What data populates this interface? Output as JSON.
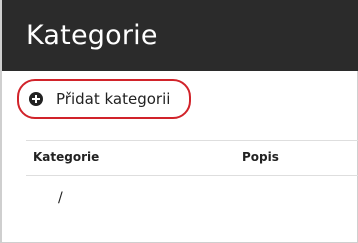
{
  "header": {
    "title": "Kategorie"
  },
  "toolbar": {
    "add_label": "Přidat kategorii",
    "add_icon": "plus-circle-icon",
    "highlight_color": "#d1232a"
  },
  "table": {
    "columns": [
      "Kategorie",
      "Popis"
    ],
    "rows": [
      {
        "category": "/",
        "description": ""
      }
    ]
  }
}
